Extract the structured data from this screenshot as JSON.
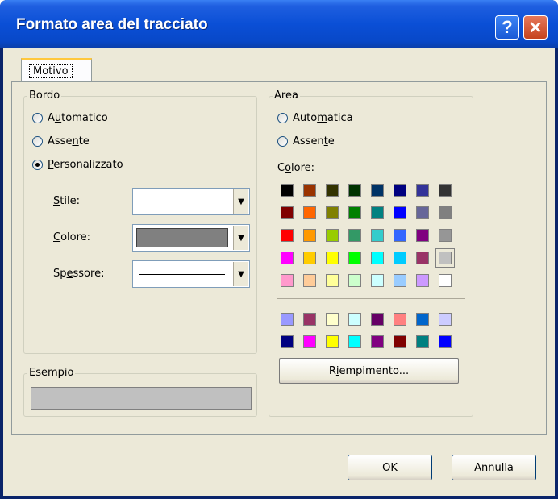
{
  "dialog": {
    "title": "Formato area del tracciato",
    "help_label": "?",
    "close_label": "✕"
  },
  "tabs": [
    {
      "label": "Motivo",
      "selected": true
    }
  ],
  "border_group": {
    "title": "Bordo",
    "options": [
      {
        "pre": "A",
        "key": "u",
        "post": "tomatico",
        "checked": false
      },
      {
        "pre": "Asse",
        "key": "n",
        "post": "te",
        "checked": false
      },
      {
        "pre": "",
        "key": "P",
        "post": "ersonalizzato",
        "checked": true
      }
    ],
    "style": {
      "pre": "",
      "key": "S",
      "post": "tile:"
    },
    "color": {
      "pre": "",
      "key": "C",
      "post": "olore:",
      "value_color": "#808080"
    },
    "weight": {
      "pre": "Sp",
      "key": "e",
      "post": "ssore:"
    }
  },
  "sample_group": {
    "title": "Esempio",
    "color": "#c0c0c0"
  },
  "area_group": {
    "title": "Area",
    "options": [
      {
        "pre": "Auto",
        "key": "m",
        "post": "atica",
        "checked": true
      },
      {
        "pre": "Assen",
        "key": "t",
        "post": "e",
        "checked": false
      }
    ],
    "color_label": {
      "pre": "C",
      "key": "o",
      "post": "lore:"
    },
    "palette_main": [
      [
        "#000000",
        "#993300",
        "#333300",
        "#003300",
        "#003366",
        "#000080",
        "#333399",
        "#333333"
      ],
      [
        "#800000",
        "#ff6600",
        "#808000",
        "#008000",
        "#008080",
        "#0000ff",
        "#666699",
        "#808080"
      ],
      [
        "#ff0000",
        "#ff9900",
        "#99cc00",
        "#339966",
        "#33cccc",
        "#3366ff",
        "#800080",
        "#969696"
      ],
      [
        "#ff00ff",
        "#ffcc00",
        "#ffff00",
        "#00ff00",
        "#00ffff",
        "#00ccff",
        "#993366",
        "#c0c0c0"
      ],
      [
        "#ff99cc",
        "#ffcc99",
        "#ffff99",
        "#ccffcc",
        "#ccffff",
        "#99ccff",
        "#cc99ff",
        "#ffffff"
      ]
    ],
    "selected_swatch": "#c0c0c0",
    "palette_extra": [
      [
        "#9999ff",
        "#993366",
        "#ffffcc",
        "#ccffff",
        "#660066",
        "#ff8080",
        "#0066cc",
        "#ccccff"
      ],
      [
        "#000080",
        "#ff00ff",
        "#ffff00",
        "#00ffff",
        "#800080",
        "#800000",
        "#008080",
        "#0000ff"
      ]
    ],
    "fill_button": {
      "pre": "R",
      "key": "i",
      "post": "empimento..."
    }
  },
  "footer": {
    "ok_label": "OK",
    "cancel_label": "Annulla"
  }
}
